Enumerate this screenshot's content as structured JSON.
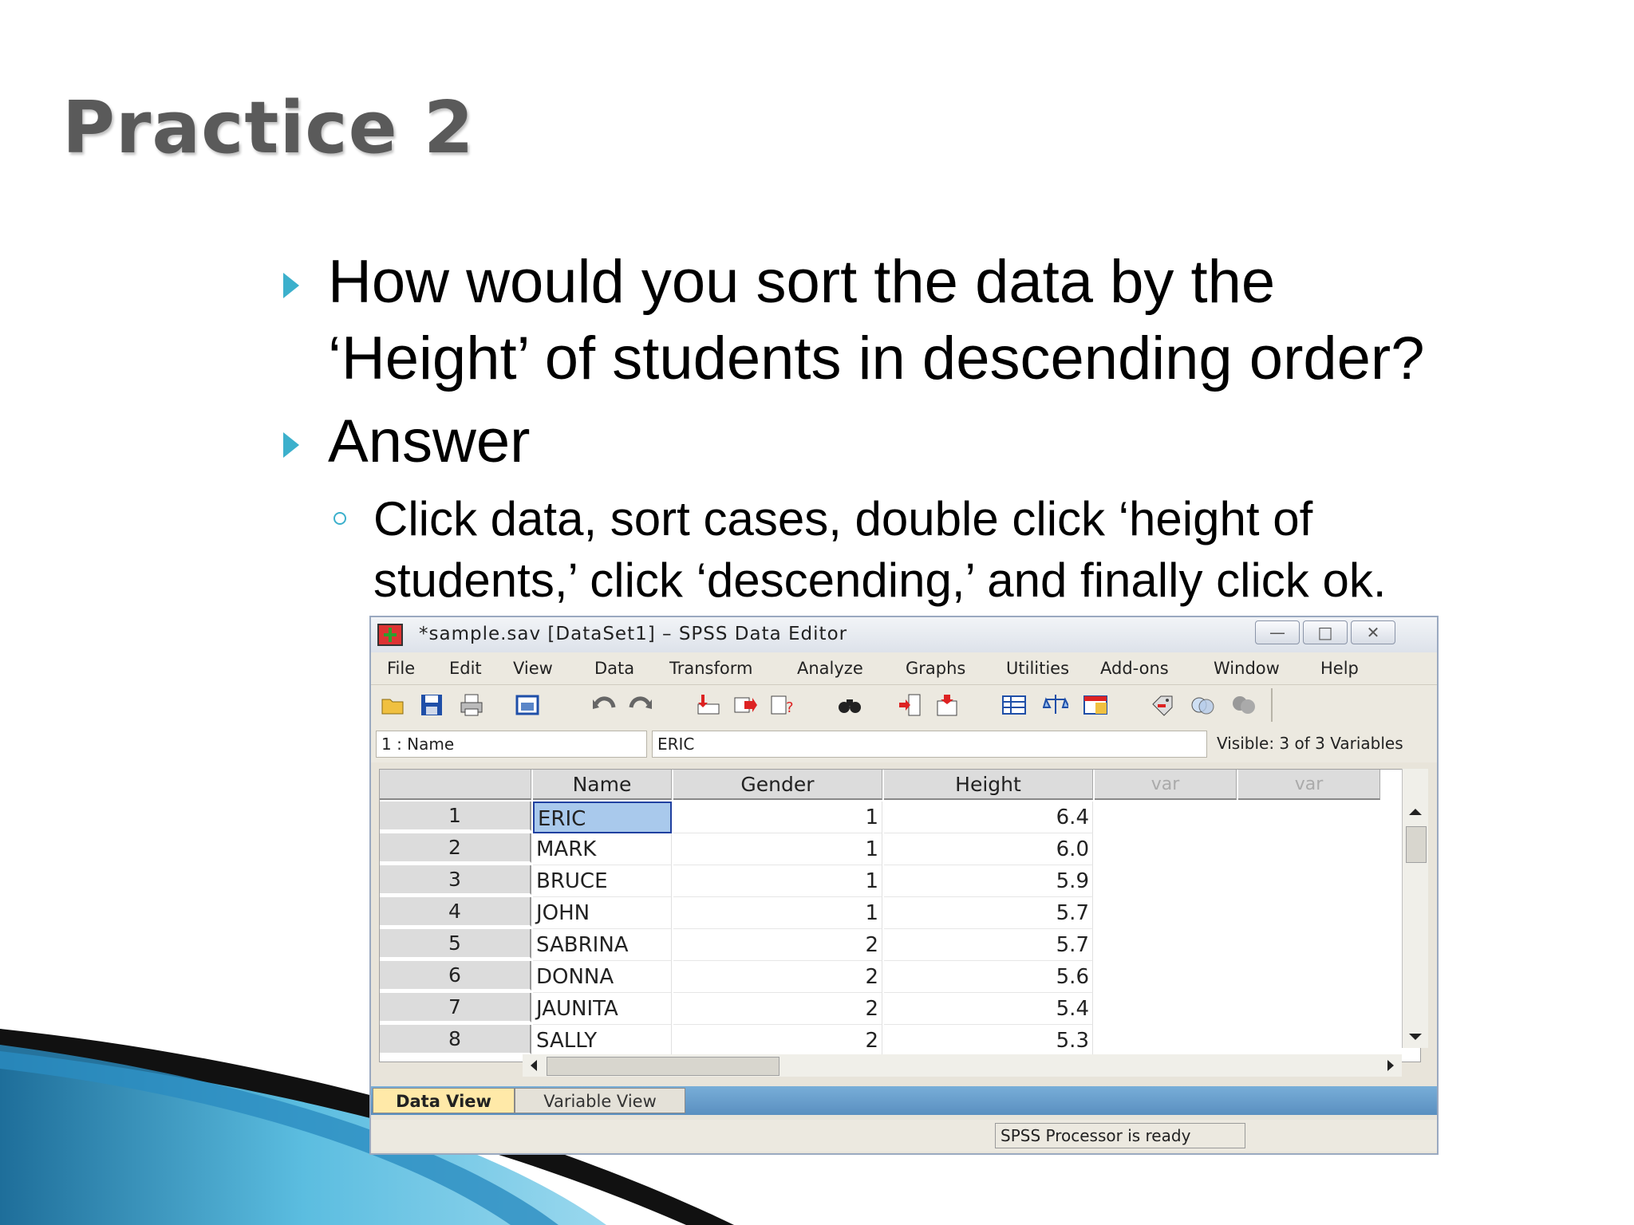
{
  "slide": {
    "title": "Practice 2",
    "bullets": [
      {
        "lines": [
          "How would you sort the data by the",
          "‘Height’ of students in descending order?"
        ]
      },
      {
        "lines": [
          "Answer"
        ]
      }
    ],
    "sub_bullet": {
      "lines": [
        "Click data, sort cases, double click ‘height of",
        "students,’ click ‘descending,’ and finally click ok."
      ]
    },
    "accent_color": "#3cb0cc"
  },
  "window": {
    "title": "*sample.sav [DataSet1] – SPSS Data Editor",
    "controls": {
      "minimize": "—",
      "maximize": "□",
      "close": "✕"
    },
    "menu": [
      "File",
      "Edit",
      "View",
      "Data",
      "Transform",
      "Analyze",
      "Graphs",
      "Utilities",
      "Add-ons",
      "Window",
      "Help"
    ],
    "toolbar_icons": [
      "open-folder-icon",
      "save-icon",
      "print-icon",
      "dialog-recall-icon",
      "undo-icon",
      "redo-icon",
      "goto-case-icon",
      "goto-variable-icon",
      "variables-icon",
      "find-icon",
      "insert-cases-icon",
      "insert-variable-icon",
      "split-file-icon",
      "weight-cases-icon",
      "select-cases-icon",
      "value-labels-icon",
      "use-sets-icon",
      "show-all-icon"
    ],
    "cell_ref": "1 : Name",
    "cell_value": "ERIC",
    "visible": "Visible: 3 of 3 Variables",
    "columns": [
      "Name",
      "Gender",
      "Height",
      "var",
      "var"
    ],
    "rows": [
      {
        "n": "1",
        "name": "ERIC",
        "gender": "1",
        "height": "6.4"
      },
      {
        "n": "2",
        "name": "MARK",
        "gender": "1",
        "height": "6.0"
      },
      {
        "n": "3",
        "name": "BRUCE",
        "gender": "1",
        "height": "5.9"
      },
      {
        "n": "4",
        "name": "JOHN",
        "gender": "1",
        "height": "5.7"
      },
      {
        "n": "5",
        "name": "SABRINA",
        "gender": "2",
        "height": "5.7"
      },
      {
        "n": "6",
        "name": "DONNA",
        "gender": "2",
        "height": "5.6"
      },
      {
        "n": "7",
        "name": "JAUNITA",
        "gender": "2",
        "height": "5.4"
      },
      {
        "n": "8",
        "name": "SALLY",
        "gender": "2",
        "height": "5.3"
      }
    ],
    "tabs": [
      "Data View",
      "Variable View"
    ],
    "status": "SPSS  Processor is ready"
  }
}
